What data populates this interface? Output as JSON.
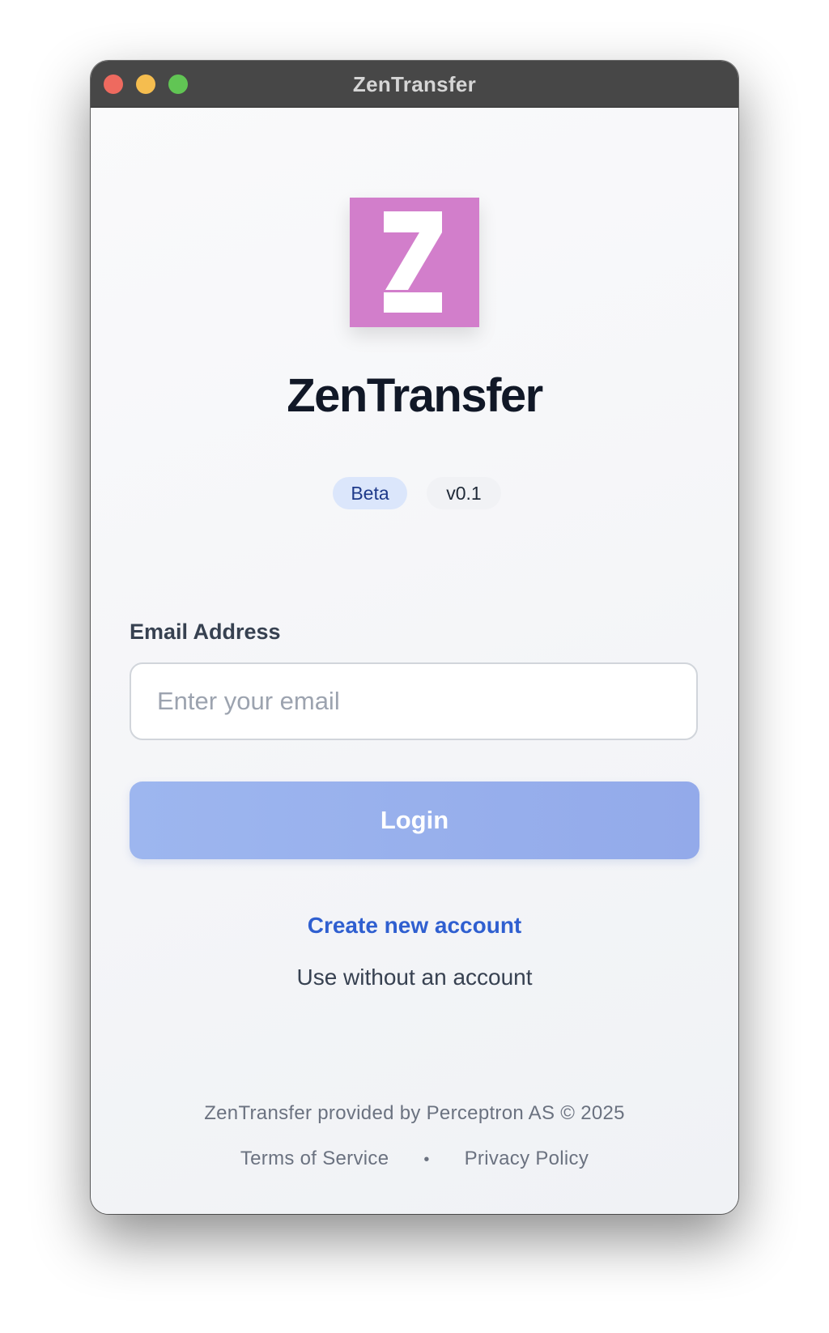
{
  "window": {
    "title": "ZenTransfer"
  },
  "branding": {
    "logo_icon": "zentransfer-z-logo",
    "logo_color": "#d27ecb",
    "app_name": "ZenTransfer",
    "beta_badge": "Beta",
    "version_badge": "v0.1"
  },
  "login_form": {
    "email_label": "Email Address",
    "email_placeholder": "Enter your email",
    "email_value": "",
    "login_button_label": "Login",
    "login_button_color": "#98b0ed"
  },
  "links": {
    "create_account": "Create new account",
    "use_without_account": "Use without an account",
    "link_color": "#2f5fd0"
  },
  "footer": {
    "provider_text": "ZenTransfer provided by Perceptron AS © 2025",
    "terms_link": "Terms of Service",
    "separator": "•",
    "privacy_link": "Privacy Policy"
  }
}
